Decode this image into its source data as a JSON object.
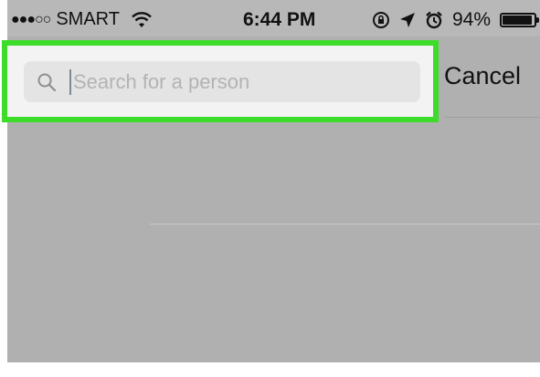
{
  "status_bar": {
    "signal": "●●●○○",
    "carrier": "SMART",
    "time": "6:44 PM",
    "battery": "94%",
    "battery_level": 0.94,
    "icons": [
      "wifi-icon",
      "rotation-lock-icon",
      "location-arrow-icon",
      "alarm-icon",
      "battery-icon"
    ]
  },
  "search": {
    "placeholder": "Search for a person",
    "value": "",
    "cancel_label": "Cancel"
  },
  "colors": {
    "highlight": "#3ddc2a",
    "dim_overlay": "#b0b0b0"
  }
}
